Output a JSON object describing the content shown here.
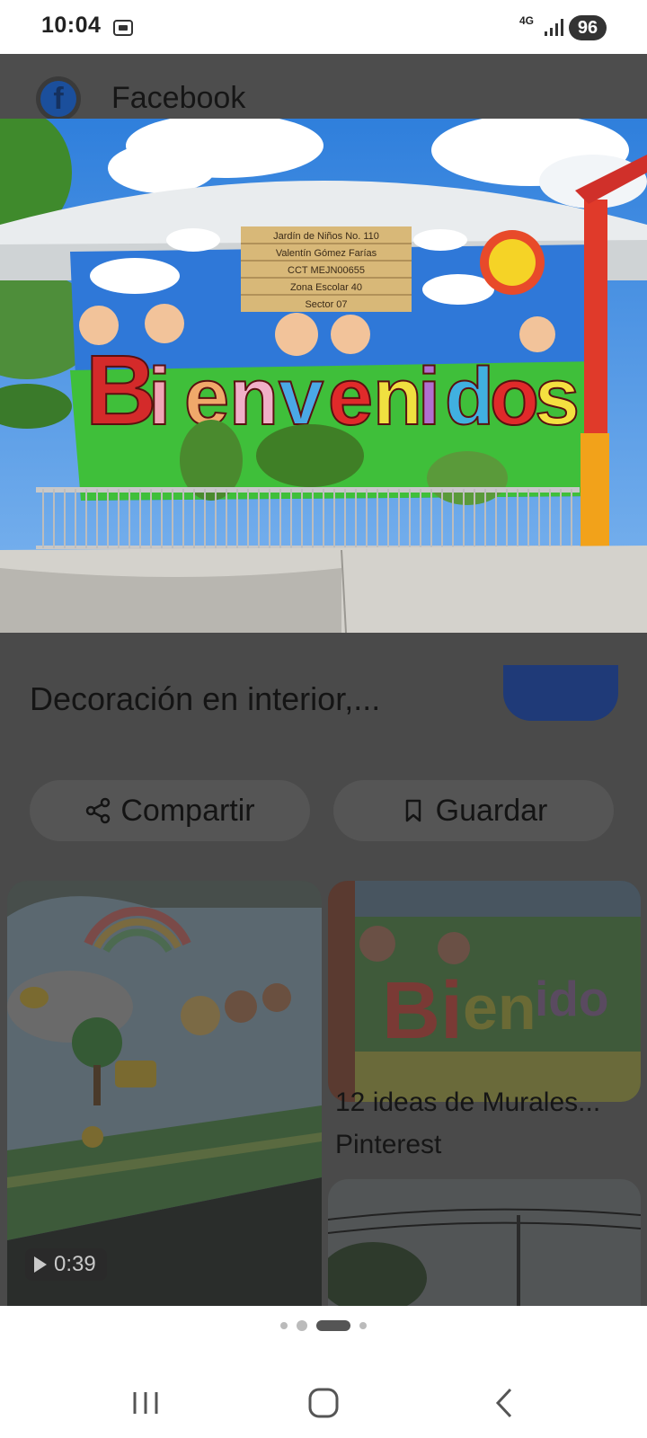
{
  "status_bar": {
    "time": "10:04",
    "network": "4G",
    "battery": "96"
  },
  "source_header": {
    "site_name": "Facebook"
  },
  "hero_image": {
    "sign_lines": [
      "Jardín de Niños No. 110",
      "Valentín Gómez Farías",
      "CCT MEJN00655",
      "Zona Escolar 40",
      "Sector 07"
    ],
    "mural_word": "Bienvenidos"
  },
  "result": {
    "title_line": "Decoración en interior,..."
  },
  "actions": {
    "share_label": "Compartir",
    "save_label": "Guardar"
  },
  "related": [
    {
      "duration": "0:39"
    },
    {
      "title": "12 ideas de Murales...",
      "source": "Pinterest"
    }
  ],
  "pager": {
    "count": 4,
    "active": 2
  },
  "icons": {
    "share": "share-icon",
    "save": "bookmark-icon",
    "play": "play-icon",
    "recents": "recents-icon",
    "home": "home-icon",
    "back": "back-icon"
  },
  "colors": {
    "overlay": "#4a4a4a",
    "facebook_blue": "#1b4f9c"
  }
}
